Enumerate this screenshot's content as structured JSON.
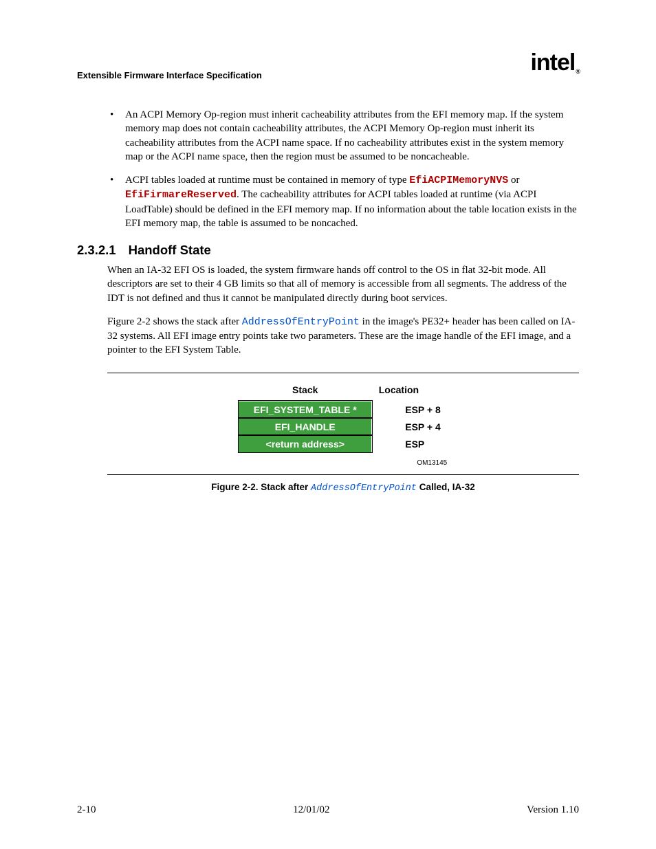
{
  "header": {
    "doc_title": "Extensible Firmware Interface Specification",
    "logo_text": "intel",
    "logo_r": "®"
  },
  "bullets": {
    "b1_pre": "An ACPI Memory Op-region must inherit cacheability attributes from the EFI memory map. If the system memory map does not contain cacheability attributes, the ACPI Memory Op-region must inherit its cacheability attributes from the ACPI name space. If no cacheability attributes exist in the system memory map or the ACPI name space, then the region must be assumed to be noncacheable.",
    "b2_a": "ACPI tables loaded at runtime must be contained in memory of type ",
    "b2_code1": "EfiACPIMemoryNVS",
    "b2_b": " or ",
    "b2_code2": "EfiFirmareReserved",
    "b2_c": ".  The cacheability attributes for ACPI tables loaded at runtime (via ACPI LoadTable) should be defined in the EFI memory map. If no information about the table location exists in the EFI memory map, the table is assumed to be noncached."
  },
  "section": {
    "number": "2.3.2.1",
    "title": "Handoff State"
  },
  "paras": {
    "p1": "When an IA-32 EFI OS is loaded, the system firmware hands off control to the OS in flat 32-bit mode.  All descriptors are set to their 4 GB limits so that all of memory is accessible from all segments.  The address of the IDT is not defined and thus it cannot be manipulated directly during boot services.",
    "p2_a": "Figure 2-2 shows the stack after ",
    "p2_code": "AddressOfEntryPoint",
    "p2_b": " in the image's PE32+ header has been called on IA-32 systems.  All EFI image entry points take two parameters.  These are the image handle of the EFI image, and a pointer to the EFI System Table."
  },
  "chart_data": {
    "type": "table",
    "title": "Stack after AddressOfEntryPoint Called, IA-32",
    "columns": [
      "Stack",
      "Location"
    ],
    "rows": [
      {
        "stack": "EFI_SYSTEM_TABLE *",
        "location": "ESP + 8"
      },
      {
        "stack": "EFI_HANDLE",
        "location": "ESP + 4"
      },
      {
        "stack": "<return address>",
        "location": "ESP"
      }
    ],
    "om_id": "OM13145"
  },
  "figure_caption": {
    "prefix": "Figure 2-2.  Stack after ",
    "code": "AddressOfEntryPoint",
    "suffix": " Called, IA-32"
  },
  "footer": {
    "left": "2-10",
    "center": "12/01/02",
    "right": "Version 1.10"
  }
}
